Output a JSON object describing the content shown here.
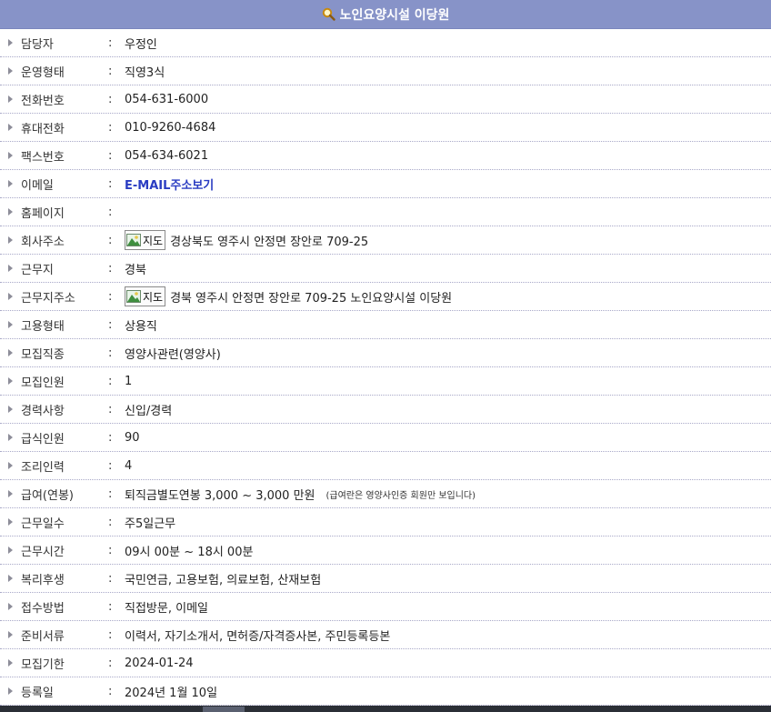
{
  "header": {
    "title": "노인요양시설 이당원",
    "icon": "magnifier-icon"
  },
  "rows": [
    {
      "label": "담당자",
      "value": "우정인"
    },
    {
      "label": "운영형태",
      "value": "직영3식"
    },
    {
      "label": "전화번호",
      "value": "054-631-6000"
    },
    {
      "label": "휴대전화",
      "value": "010-9260-4684"
    },
    {
      "label": "팩스번호",
      "value": "054-634-6021"
    },
    {
      "label": "이메일",
      "value": "E-MAIL주소보기"
    },
    {
      "label": "홈페이지",
      "value": ""
    },
    {
      "label": "회사주소",
      "value": "경상북도 영주시 안정면 장안로 709-25",
      "map_label": "지도"
    },
    {
      "label": "근무지",
      "value": "경북"
    },
    {
      "label": "근무지주소",
      "value": "경북 영주시 안정면 장안로 709-25 노인요양시설 이당원",
      "map_label": "지도"
    },
    {
      "label": "고용형태",
      "value": "상용직"
    },
    {
      "label": "모집직종",
      "value": "영양사관련(영양사)"
    },
    {
      "label": "모집인원",
      "value": "1"
    },
    {
      "label": "경력사항",
      "value": "신입/경력"
    },
    {
      "label": "급식인원",
      "value": "90"
    },
    {
      "label": "조리인력",
      "value": "4"
    },
    {
      "label": "급여(연봉)",
      "value": "퇴직금별도연봉 3,000 ~ 3,000 만원",
      "note": "(급여란은 영양사인증 회원만 보입니다)"
    },
    {
      "label": "근무일수",
      "value": "주5일근무"
    },
    {
      "label": "근무시간",
      "value": "09시 00분 ~ 18시 00분"
    },
    {
      "label": "복리후생",
      "value": "국민연금, 고용보험, 의료보험, 산재보험"
    },
    {
      "label": "접수방법",
      "value": "직접방문, 이메일"
    },
    {
      "label": "준비서류",
      "value": "이력서, 자기소개서, 면허증/자격증사본, 주민등록등본"
    },
    {
      "label": "모집기한",
      "value": "2024-01-24"
    },
    {
      "label": "등록일",
      "value": "2024년 1월 10일"
    }
  ],
  "colon": ":",
  "colors": {
    "header_bg": "#8793c8",
    "email_link": "#2a3cc2",
    "row_divider": "#a8a8c8"
  }
}
